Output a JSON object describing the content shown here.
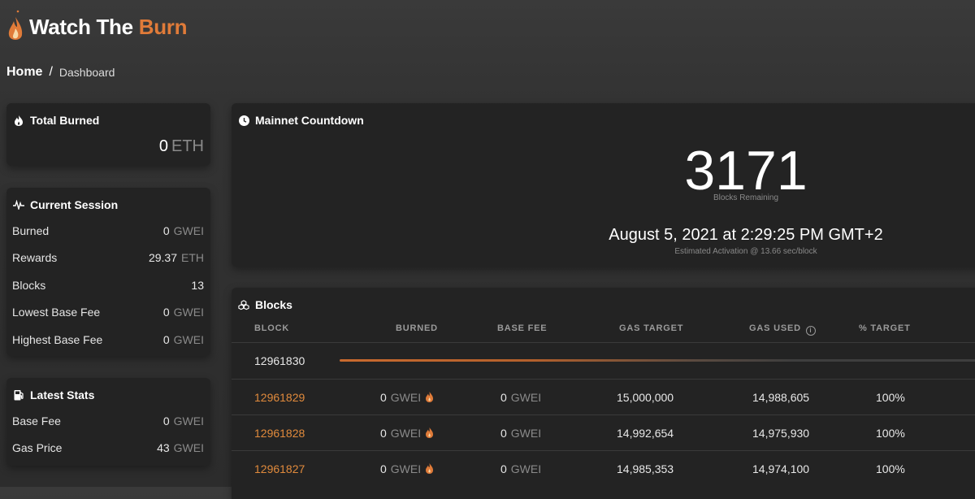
{
  "app": {
    "title_main": "Watch The",
    "title_accent": "Burn"
  },
  "breadcrumb": {
    "home": "Home",
    "separator": "/",
    "current": "Dashboard"
  },
  "colors": {
    "accent": "#e07b39",
    "link": "#e08a3c",
    "card": "#232323",
    "muted": "#8a8a8a"
  },
  "total_burned": {
    "title": "Total Burned",
    "icon": "flame-icon",
    "value": "0",
    "unit": "ETH"
  },
  "current_session": {
    "title": "Current Session",
    "icon": "pulse-icon",
    "rows": [
      {
        "label": "Burned",
        "value": "0",
        "unit": "GWEI"
      },
      {
        "label": "Rewards",
        "value": "29.37",
        "unit": "ETH"
      },
      {
        "label": "Blocks",
        "value": "13",
        "unit": ""
      },
      {
        "label": "Lowest Base Fee",
        "value": "0",
        "unit": "GWEI"
      },
      {
        "label": "Highest Base Fee",
        "value": "0",
        "unit": "GWEI"
      }
    ]
  },
  "latest_stats": {
    "title": "Latest Stats",
    "icon": "gas-pump-icon",
    "rows": [
      {
        "label": "Base Fee",
        "value": "0",
        "unit": "GWEI"
      },
      {
        "label": "Gas Price",
        "value": "43",
        "unit": "GWEI"
      }
    ]
  },
  "countdown": {
    "title": "Mainnet Countdown",
    "icon": "clock-icon",
    "blocks_remaining": "3171",
    "blocks_label": "Blocks Remaining",
    "activation_date": "August 5, 2021 at 2:29:25 PM GMT+2",
    "estimate_note": "Estimated Activation @ 13.66 sec/block"
  },
  "blocks": {
    "title": "Blocks",
    "icon": "cubes-icon",
    "columns": [
      "BLOCK",
      "BURNED",
      "BASE FEE",
      "GAS TARGET",
      "GAS USED",
      "% TARGET"
    ],
    "pending": {
      "block": "12961830"
    },
    "rows": [
      {
        "block": "12961829",
        "burned": "0",
        "burned_unit": "GWEI",
        "base_fee": "0",
        "base_fee_unit": "GWEI",
        "gas_target": "15,000,000",
        "gas_used": "14,988,605",
        "pct_target": "100%"
      },
      {
        "block": "12961828",
        "burned": "0",
        "burned_unit": "GWEI",
        "base_fee": "0",
        "base_fee_unit": "GWEI",
        "gas_target": "14,992,654",
        "gas_used": "14,975,930",
        "pct_target": "100%"
      },
      {
        "block": "12961827",
        "burned": "0",
        "burned_unit": "GWEI",
        "base_fee": "0",
        "base_fee_unit": "GWEI",
        "gas_target": "14,985,353",
        "gas_used": "14,974,100",
        "pct_target": "100%"
      }
    ]
  }
}
